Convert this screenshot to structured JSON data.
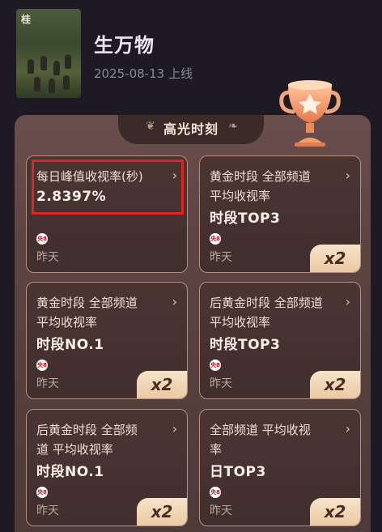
{
  "header": {
    "poster_title": "桂",
    "title": "生万物",
    "release_date": "2025-08-13 上线"
  },
  "highlights": {
    "section_title": "高光时刻",
    "cards": [
      {
        "line1": "每日峰值收视率(秒)",
        "line2": "",
        "value": "2.8397%",
        "channel_badge": "央8",
        "when": "昨天",
        "multiplier": ""
      },
      {
        "line1": "黄金时段 全部频道",
        "line2": "平均收视率",
        "value": "时段TOP3",
        "channel_badge": "央8",
        "when": "昨天",
        "multiplier": "x2"
      },
      {
        "line1": "黄金时段 全部频道",
        "line2": "平均收视率",
        "value": "时段NO.1",
        "channel_badge": "央8",
        "when": "昨天",
        "multiplier": "x2"
      },
      {
        "line1": "后黄金时段 全部频道",
        "line2": "平均收视率",
        "value": "时段TOP3",
        "channel_badge": "央8",
        "when": "昨天",
        "multiplier": "x2"
      },
      {
        "line1": "后黄金时段 全部频",
        "line2": "道 平均收视率",
        "value": "时段NO.1",
        "channel_badge": "央8",
        "when": "昨天",
        "multiplier": "x2"
      },
      {
        "line1": "全部频道 平均收视",
        "line2": "率",
        "value": "日TOP3",
        "channel_badge": "央8",
        "when": "昨天",
        "multiplier": "x2"
      }
    ]
  },
  "colors": {
    "background": "#1d1a26",
    "panel": "#5c4442",
    "card_border": "#b58f7f",
    "multiplier_badge": "#f2d6b6",
    "highlight_box": "#e02424",
    "trophy": "#f0a06a"
  },
  "icons": {
    "chevron": "chevron-right-icon",
    "trophy": "trophy-icon",
    "channel": "cctv8-logo-icon"
  }
}
